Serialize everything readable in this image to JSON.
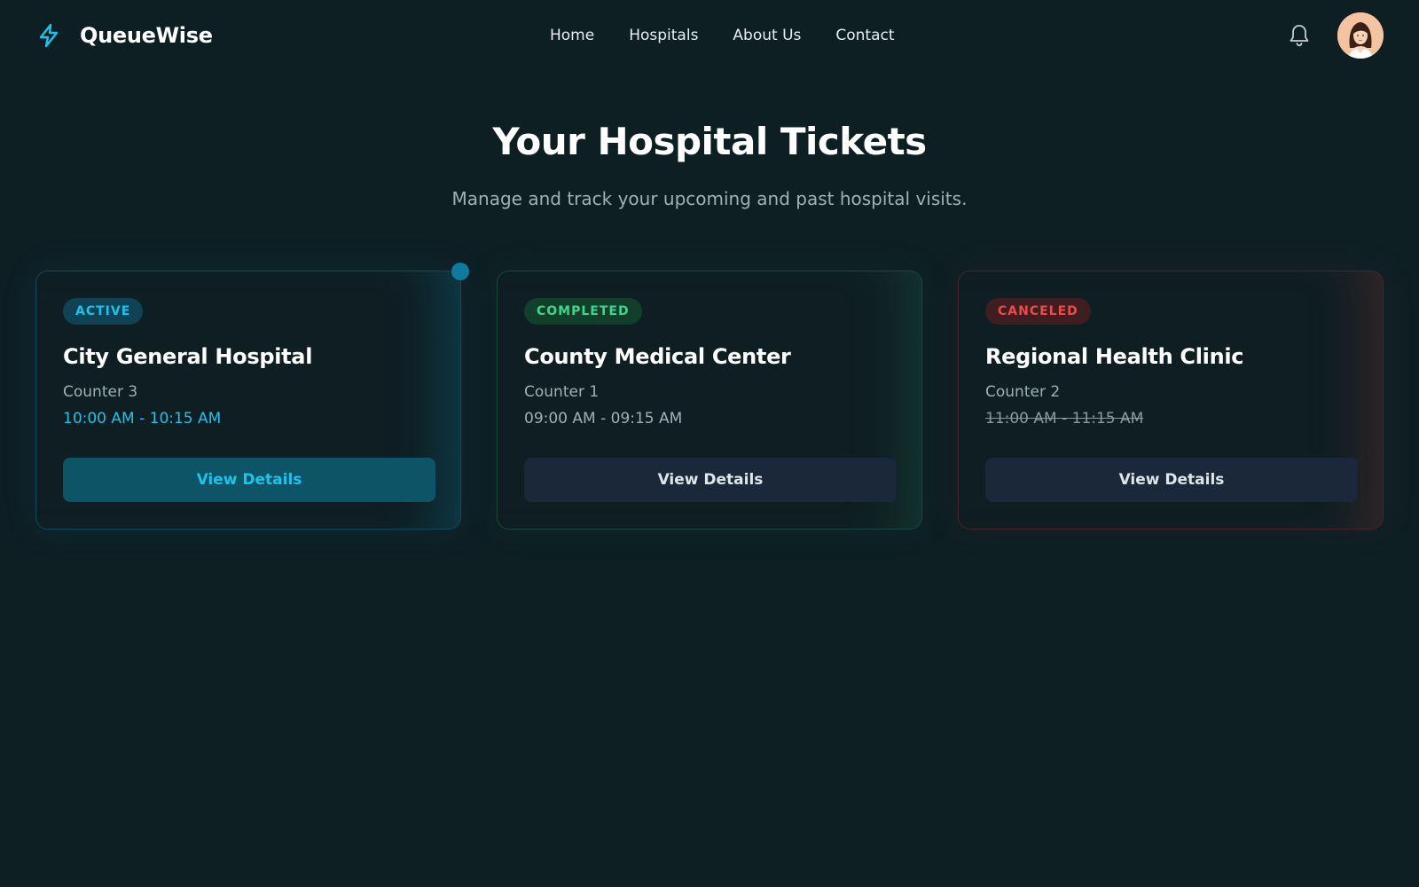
{
  "app": {
    "brand": "QueueWise",
    "brand_icon": "lightning-bolt-icon",
    "accent": "#1cc3ea"
  },
  "nav": {
    "items": [
      {
        "label": "Home"
      },
      {
        "label": "Hospitals"
      },
      {
        "label": "About Us"
      },
      {
        "label": "Contact"
      }
    ]
  },
  "header": {
    "notifications_icon": "bell-icon",
    "avatar": "user-avatar"
  },
  "hero": {
    "title": "Your Hospital Tickets",
    "subtitle": "Manage and track your upcoming and past hospital visits."
  },
  "tickets": [
    {
      "status": "ACTIVE",
      "status_color": "#1cc3ea",
      "hospital": "City General Hospital",
      "counter": "Counter 3",
      "time": "10:00 AM - 10:15 AM",
      "button": "View Details"
    },
    {
      "status": "COMPLETED",
      "status_color": "#3fd68a",
      "hospital": "County Medical Center",
      "counter": "Counter 1",
      "time": "09:00 AM - 09:15 AM",
      "button": "View Details"
    },
    {
      "status": "CANCELED",
      "status_color": "#ee4a4a",
      "hospital": "Regional Health Clinic",
      "counter": "Counter 2",
      "time": "11:00 AM - 11:15 AM",
      "button": "View Details"
    }
  ]
}
